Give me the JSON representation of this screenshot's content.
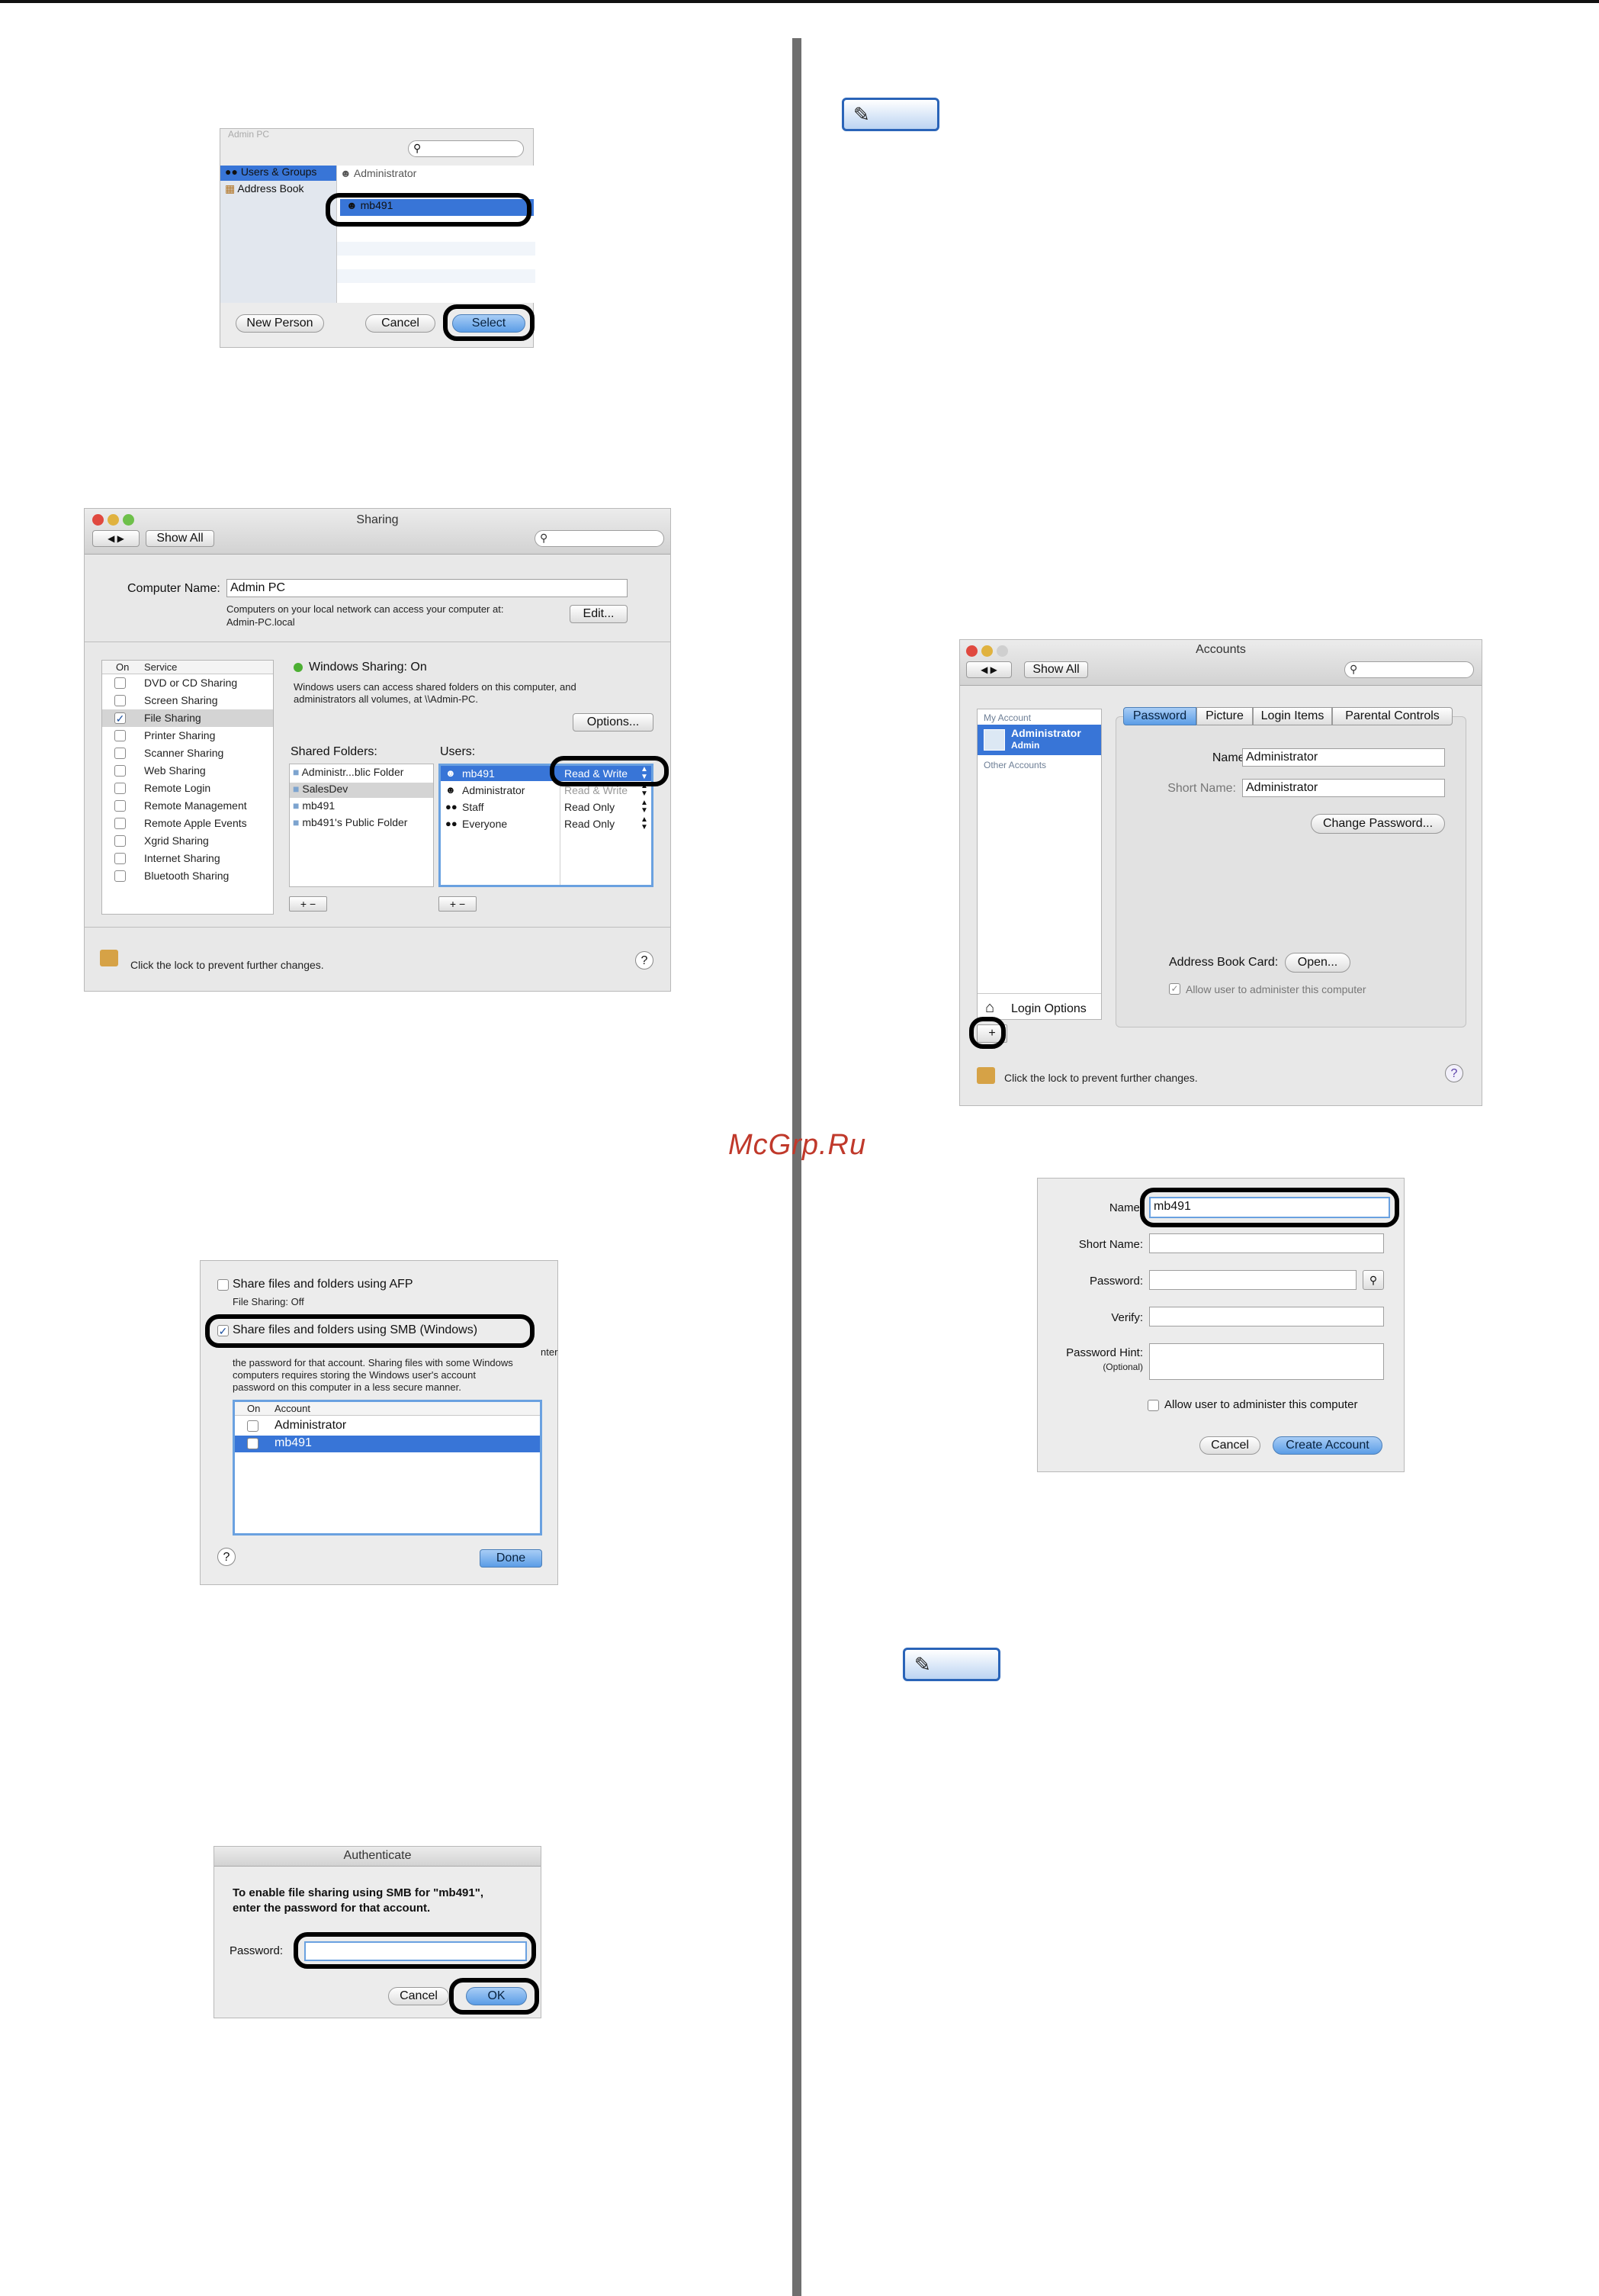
{
  "watermark": "McGrp.Ru",
  "people_picker": {
    "partial_header": "Admin PC",
    "search_placeholder": "",
    "left_items": [
      "Users & Groups",
      "Address Book"
    ],
    "right_items": [
      "Administrator",
      "mb491"
    ],
    "new_person_button": "New Person",
    "cancel_button": "Cancel",
    "select_button": "Select"
  },
  "sharing": {
    "title": "Sharing",
    "show_all": "Show All",
    "computer_name_label": "Computer Name:",
    "computer_name_value": "Admin PC",
    "computer_name_note_1": "Computers on your local network can access your computer at:",
    "computer_name_note_2": "Admin-PC.local",
    "edit_button": "Edit...",
    "col_on": "On",
    "col_service": "Service",
    "services": [
      {
        "name": "DVD or CD Sharing",
        "checked": false
      },
      {
        "name": "Screen Sharing",
        "checked": false
      },
      {
        "name": "File Sharing",
        "checked": true
      },
      {
        "name": "Printer Sharing",
        "checked": false
      },
      {
        "name": "Scanner Sharing",
        "checked": false
      },
      {
        "name": "Web Sharing",
        "checked": false
      },
      {
        "name": "Remote Login",
        "checked": false
      },
      {
        "name": "Remote Management",
        "checked": false
      },
      {
        "name": "Remote Apple Events",
        "checked": false
      },
      {
        "name": "Xgrid Sharing",
        "checked": false
      },
      {
        "name": "Internet Sharing",
        "checked": false
      },
      {
        "name": "Bluetooth Sharing",
        "checked": false
      }
    ],
    "status": "Windows Sharing: On",
    "status_note_1": "Windows users can access shared folders on this computer, and",
    "status_note_2": "administrators all volumes, at \\\\Admin-PC.",
    "options_button": "Options...",
    "shared_folders_label": "Shared Folders:",
    "users_label": "Users:",
    "folders": [
      "Administr...blic Folder",
      "SalesDev",
      "mb491",
      "mb491's Public Folder"
    ],
    "users": [
      {
        "name": "mb491",
        "perm": "Read & Write"
      },
      {
        "name": "Administrator",
        "perm": "Read & Write"
      },
      {
        "name": "Staff",
        "perm": "Read Only"
      },
      {
        "name": "Everyone",
        "perm": "Read Only"
      }
    ],
    "plus": "+",
    "minus": "−",
    "lock_text": "Click the lock to prevent further changes.",
    "help": "?"
  },
  "smb": {
    "afp_label": "Share files and folders using AFP",
    "afp_status": "File Sharing: Off",
    "smb_label": "Share files and folders using SMB (Windows)",
    "smb_frag": "nter",
    "note_1": "the password for that account. Sharing files with some Windows",
    "note_2": "computers requires storing the Windows user's account",
    "note_3": "password on this computer in a less secure manner.",
    "col_on": "On",
    "col_account": "Account",
    "accounts": [
      "Administrator",
      "mb491"
    ],
    "help": "?",
    "done_button": "Done"
  },
  "auth": {
    "title": "Authenticate",
    "message_1": "To enable file sharing using SMB for \"mb491\",",
    "message_2": "enter the password for that account.",
    "password_label": "Password:",
    "cancel_button": "Cancel",
    "ok_button": "OK"
  },
  "accounts": {
    "title": "Accounts",
    "show_all": "Show All",
    "my_account": "My Account",
    "admin_name": "Administrator",
    "admin_role": "Admin",
    "other_accounts": "Other Accounts",
    "login_options": "Login Options",
    "tabs": [
      "Password",
      "Picture",
      "Login Items",
      "Parental Controls"
    ],
    "name_label": "Name:",
    "name_value": "Administrator",
    "short_name_label": "Short Name:",
    "short_name_value": "Administrator",
    "change_password_button": "Change Password...",
    "address_book_label": "Address Book Card:",
    "open_button": "Open...",
    "allow_admin": "Allow user to administer this computer",
    "plus": "+",
    "lock_text": "Click the lock to prevent further changes.",
    "help": "?"
  },
  "new_account": {
    "name_label": "Name:",
    "name_value": "mb491",
    "short_name_label": "Short Name:",
    "password_label": "Password:",
    "verify_label": "Verify:",
    "hint_label": "Password Hint:",
    "hint_optional": "(Optional)",
    "allow_admin": "Allow user to administer this computer",
    "cancel_button": "Cancel",
    "create_button": "Create Account"
  },
  "colors": {
    "selection": "#3875d7",
    "highlight_outline": "#000000",
    "divider": "#6f6f6f",
    "memo_border": "#2a64b8",
    "watermark": "#c0392b"
  }
}
